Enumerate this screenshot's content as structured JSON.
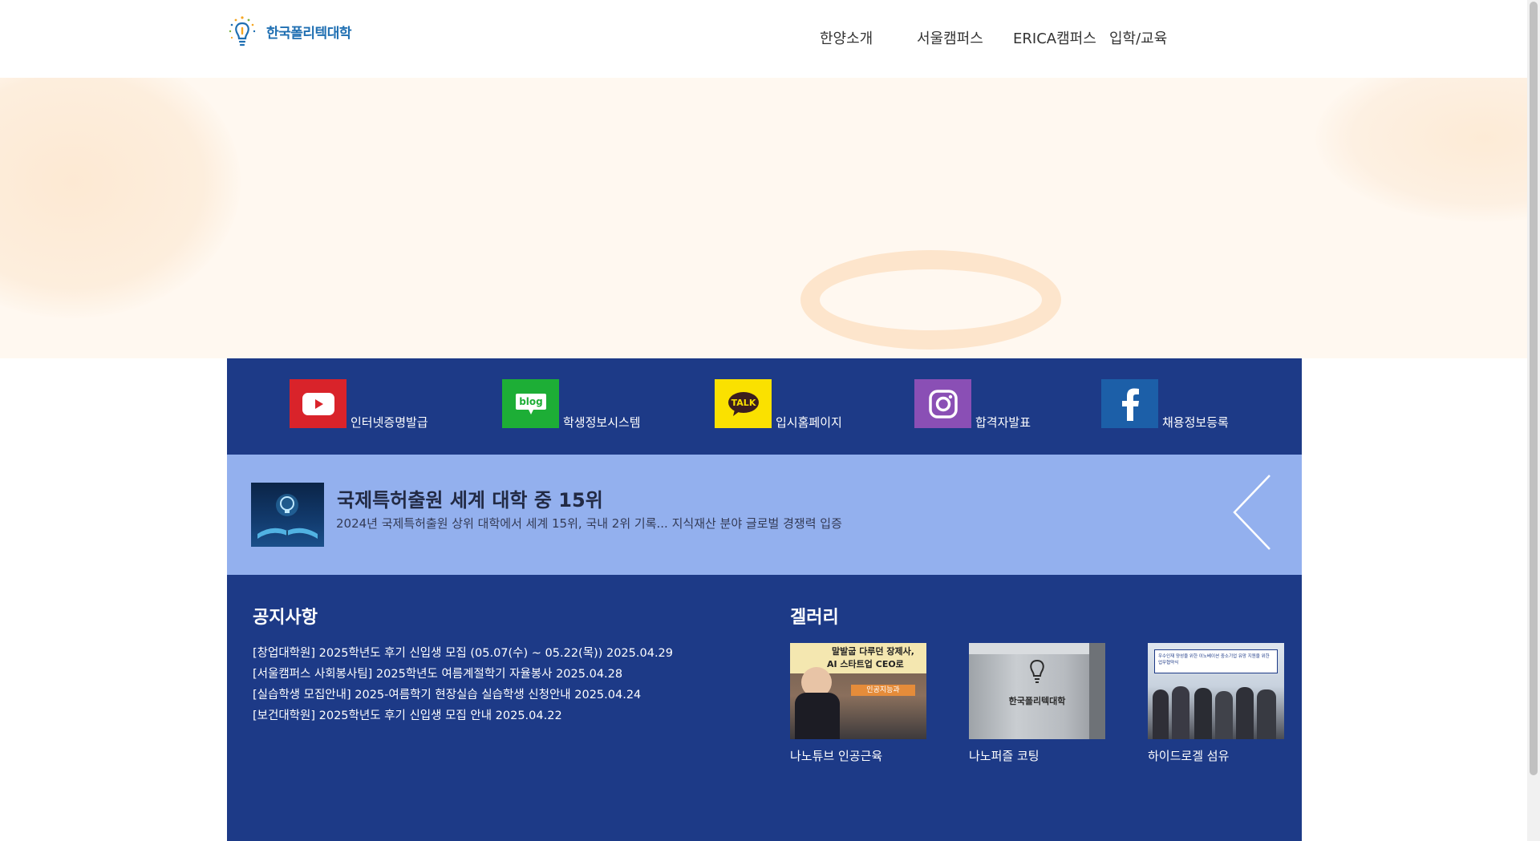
{
  "header": {
    "logo_text": "한국폴리텍대학",
    "nav": [
      {
        "label": "한양소개"
      },
      {
        "label": "서울캠퍼스"
      },
      {
        "label": "ERICA캠퍼스"
      },
      {
        "label": "입학/교육"
      }
    ]
  },
  "quick_links": [
    {
      "icon": "youtube-icon",
      "label": "인터넷증명발급",
      "color": "#d9232a"
    },
    {
      "icon": "blog-icon",
      "label": "학생정보시스템",
      "color": "#1dae36"
    },
    {
      "icon": "kakaotalk-icon",
      "label": "입시홈페이지",
      "color": "#fae100"
    },
    {
      "icon": "instagram-icon",
      "label": "합격자발표",
      "color": "#8a4fb5"
    },
    {
      "icon": "facebook-icon",
      "label": "채용정보등록",
      "color": "#1c5fa8"
    }
  ],
  "feature": {
    "title": "국제특허출원 세계 대학 중 15위",
    "description": "2024년 국제특허출원 상위 대학에서 세계 15위, 국내 2위 기록... 지식재산 분야 글로벌 경쟁력 입증"
  },
  "notices": {
    "title": "공지사항",
    "items": [
      "[창업대학원] 2025학년도 후기 신입생 모집 (05.07(수) ~ 05.22(목)) 2025.04.29",
      "[서울캠퍼스 사회봉사팀] 2025학년도 여름계절학기 자율봉사 2025.04.28",
      "[실습학생 모집안내] 2025-여름학기 현장실습 실습학생 신청안내 2025.04.24",
      "[보건대학원] 2025학년도 후기 신입생 모집 안내 2025.04.22"
    ]
  },
  "gallery": {
    "title": "겔러리",
    "items": [
      {
        "caption": "나노튜브 인공근육",
        "overlay_line1": "말발굽 다루던 장제사,",
        "overlay_line2": "AI 스타트업 CEO로",
        "badge": "인공지능과"
      },
      {
        "caption": "나노퍼즐 코팅",
        "sign_text": "한국폴리텍대학"
      },
      {
        "caption": "하이드로겔 섬유",
        "banner_text": "우수인재 양성을 위한 이노베이션 중소기업 유망 지원을 위한 업무협약식"
      }
    ]
  },
  "colors": {
    "panel": "#1d3a87",
    "feature_band": "#93b0ee",
    "hero_bg": "#fff8f0"
  }
}
